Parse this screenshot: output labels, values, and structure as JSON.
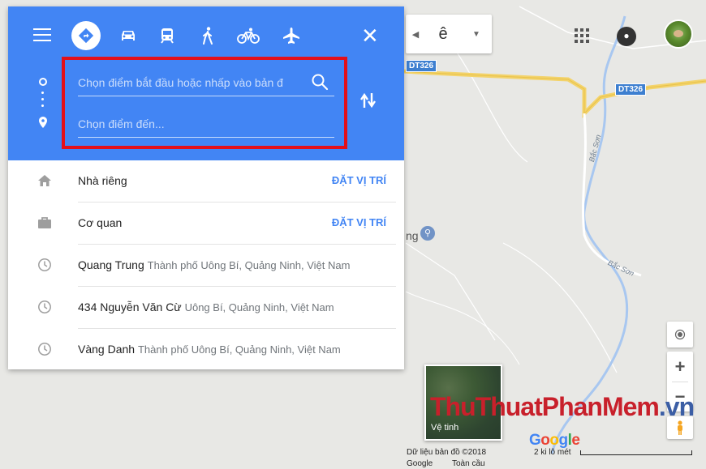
{
  "map": {
    "road_labels": [
      "DT326",
      "DT326"
    ],
    "street_labels": [
      "Bắc Sơn",
      "Bắc Sơn"
    ],
    "search_text": "ê",
    "poi_fragment": "ng",
    "satellite_label": "Vệ tinh",
    "attribution": {
      "data": "Dữ liệu bản đồ ©2018",
      "google": "Google",
      "global": "Toàn cầu",
      "scale": "2 ki lô mét"
    },
    "logo_text": "Google",
    "watermark": {
      "part1": "ThuThuat",
      "part2": "PhanMem",
      "part3": ".vn"
    }
  },
  "panel": {
    "modes": [
      "best-route",
      "driving",
      "transit",
      "walking",
      "cycling",
      "flight"
    ],
    "active_mode": "best-route",
    "origin": {
      "placeholder": "Chọn điểm bắt đầu hoặc nhấp vào bản đ",
      "value": ""
    },
    "destination": {
      "placeholder": "Chọn điểm đến...",
      "value": ""
    },
    "places": [
      {
        "icon": "home-icon",
        "label": "Nhà riêng",
        "sub": "",
        "action": "ĐẶT VỊ TRÍ"
      },
      {
        "icon": "briefcase-icon",
        "label": "Cơ quan",
        "sub": "",
        "action": "ĐẶT VỊ TRÍ"
      },
      {
        "icon": "history-icon",
        "label": "Quang Trung",
        "sub": "Thành phố Uông Bí, Quảng Ninh, Việt Nam",
        "action": ""
      },
      {
        "icon": "history-icon",
        "label": "434 Nguyễn Văn Cừ",
        "sub": "Uông Bí, Quảng Ninh, Việt Nam",
        "action": ""
      },
      {
        "icon": "history-icon",
        "label": "Vàng Danh",
        "sub": "Thành phố Uông Bí, Quảng Ninh, Việt Nam",
        "action": ""
      }
    ]
  },
  "colors": {
    "header": "#4285f4",
    "highlight": "#e3101a",
    "road": "#f3d36b",
    "river": "#a8c7f0"
  }
}
